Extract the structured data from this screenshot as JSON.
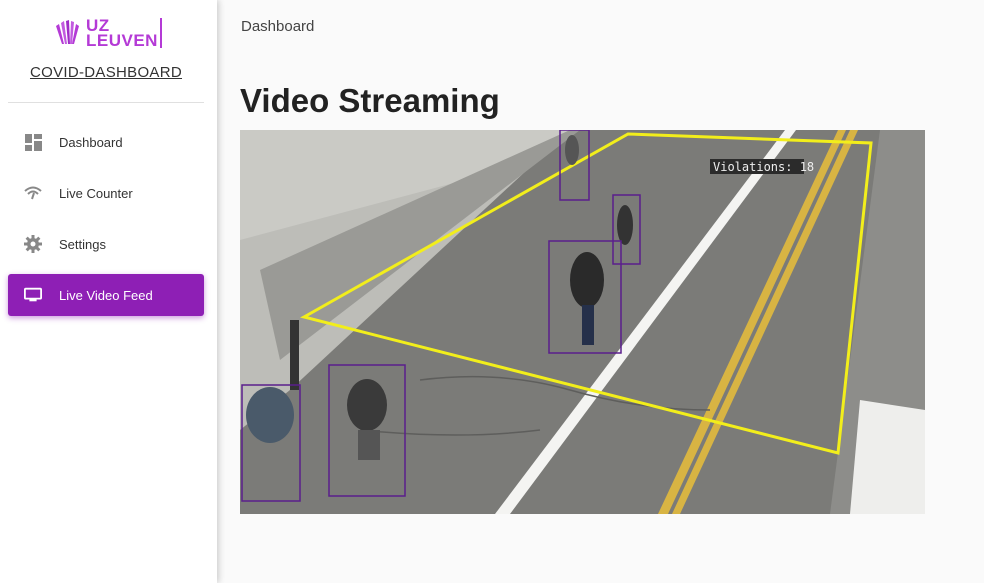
{
  "brand": {
    "logo_text_line1": "UZ",
    "logo_text_line2": "LEUVEN",
    "app_title": "COVID-DASHBOARD",
    "accent": "#8e1fb5"
  },
  "sidebar": {
    "items": [
      {
        "label": "Dashboard",
        "icon": "dashboard-icon",
        "active": false
      },
      {
        "label": "Live Counter",
        "icon": "wifi-counter-icon",
        "active": false
      },
      {
        "label": "Settings",
        "icon": "gear-icon",
        "active": false
      },
      {
        "label": "Live Video Feed",
        "icon": "monitor-icon",
        "active": true
      }
    ]
  },
  "header": {
    "breadcrumb": "Dashboard"
  },
  "main": {
    "title": "Video Streaming",
    "video": {
      "overlay_text": "Violations: 18",
      "zone_color": "#f2ee1b",
      "box_color": "#5b1e8c",
      "detections": 6
    }
  }
}
